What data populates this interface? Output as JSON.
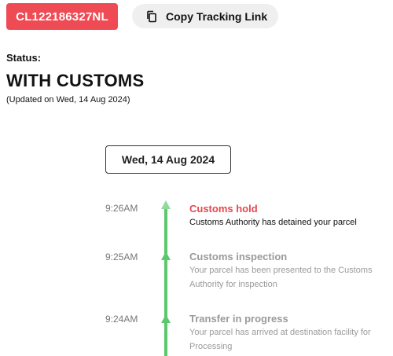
{
  "tracking": {
    "number": "CL122186327NL",
    "copy_label": "Copy Tracking Link",
    "copy_icon": "copy-icon"
  },
  "status": {
    "label": "Status:",
    "value": "WITH CUSTOMS",
    "updated": "(Updated on Wed, 14 Aug 2024)"
  },
  "timeline": {
    "date": "Wed, 14 Aug 2024",
    "events": [
      {
        "time": "9:26AM",
        "title": "Customs hold",
        "description": "Customs Authority has detained your parcel"
      },
      {
        "time": "9:25AM",
        "title": "Customs inspection",
        "description": "Your parcel has been presented to the Customs Authority for inspection"
      },
      {
        "time": "9:24AM",
        "title": "Transfer in progress",
        "description": "Your parcel has arrived at destination facility for Processing"
      }
    ]
  },
  "colors": {
    "badge": "#ef4b55",
    "active_event": "#e8474f",
    "past_event": "#9a9a9a",
    "timeline": "#5bc86a"
  }
}
